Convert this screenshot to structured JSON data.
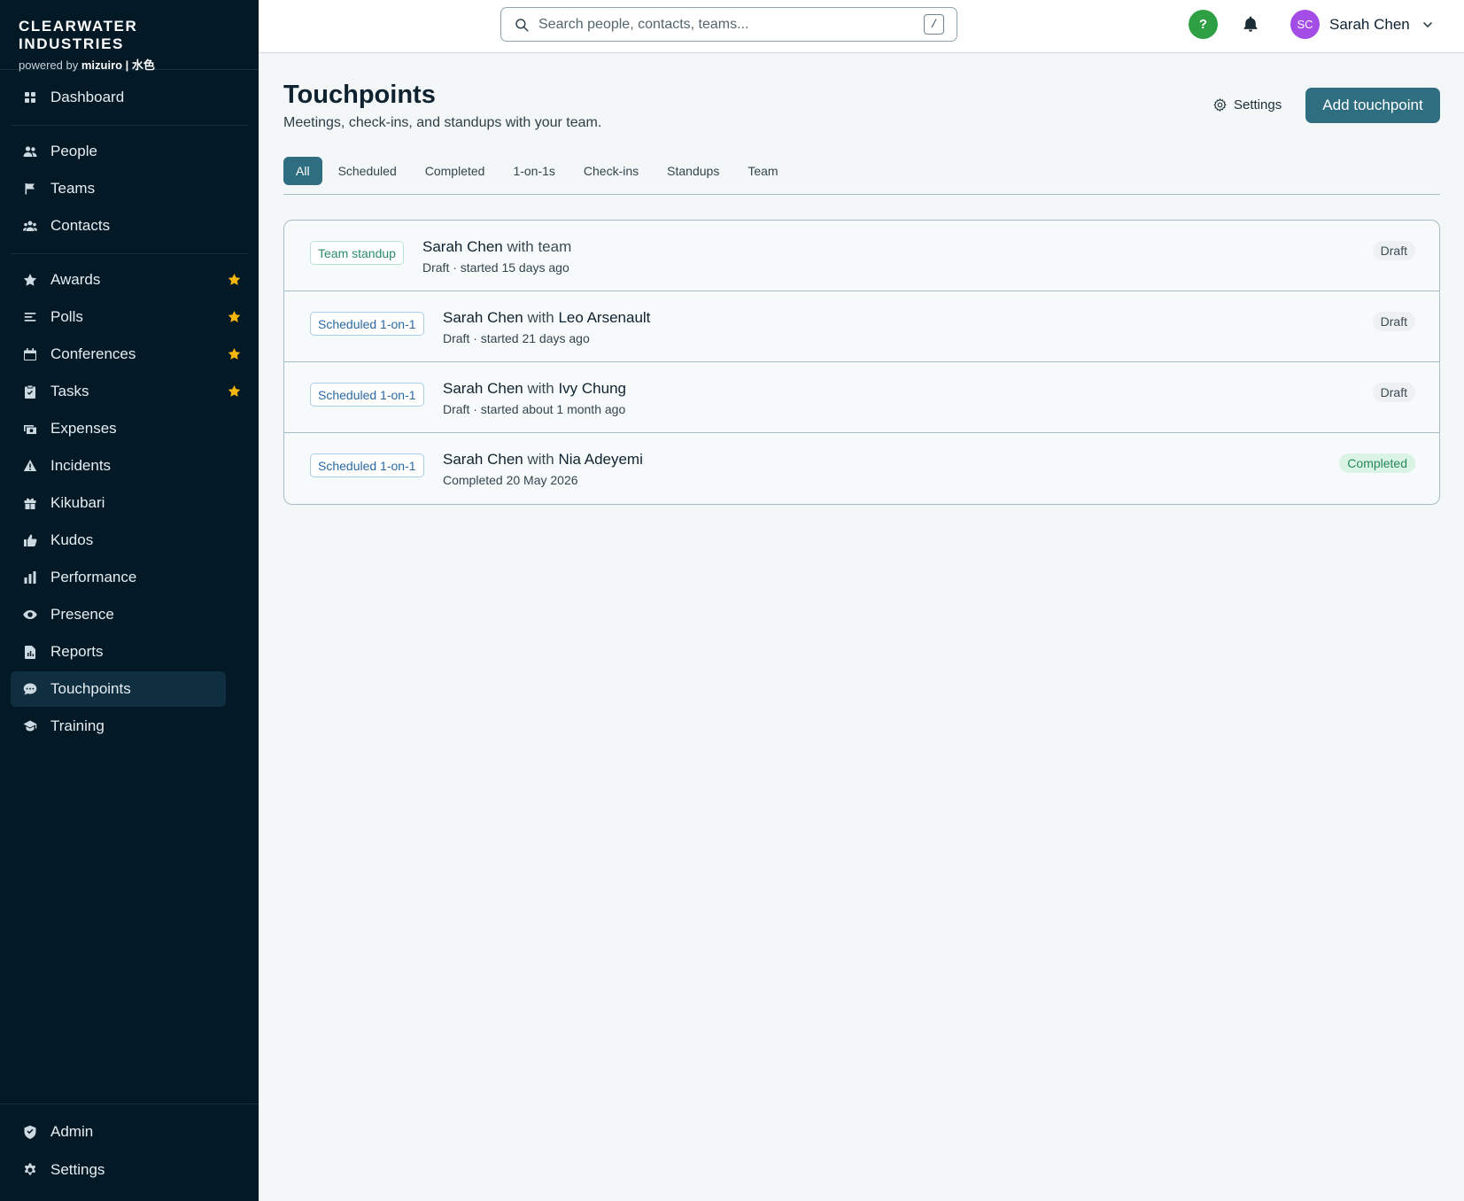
{
  "brand": {
    "name": "CLEARWATER INDUSTRIES",
    "powered_prefix": "powered by",
    "powered_name": "mizuiro | 水色"
  },
  "sidebar": {
    "items": [
      {
        "label": "Dashboard",
        "icon": "dashboard-icon",
        "starred": false,
        "active": false
      },
      {
        "label": "People",
        "icon": "people-icon",
        "starred": false,
        "active": false
      },
      {
        "label": "Teams",
        "icon": "flag-icon",
        "starred": false,
        "active": false
      },
      {
        "label": "Contacts",
        "icon": "contacts-icon",
        "starred": false,
        "active": false
      },
      {
        "label": "Awards",
        "icon": "star-icon",
        "starred": true,
        "active": false
      },
      {
        "label": "Polls",
        "icon": "polls-icon",
        "starred": true,
        "active": false
      },
      {
        "label": "Conferences",
        "icon": "calendar-icon",
        "starred": true,
        "active": false
      },
      {
        "label": "Tasks",
        "icon": "clipboard-check-icon",
        "starred": true,
        "active": false
      },
      {
        "label": "Expenses",
        "icon": "money-icon",
        "starred": false,
        "active": false
      },
      {
        "label": "Incidents",
        "icon": "warning-icon",
        "starred": false,
        "active": false
      },
      {
        "label": "Kikubari",
        "icon": "gift-icon",
        "starred": false,
        "active": false
      },
      {
        "label": "Kudos",
        "icon": "thumbs-up-icon",
        "starred": false,
        "active": false
      },
      {
        "label": "Performance",
        "icon": "bar-chart-icon",
        "starred": false,
        "active": false
      },
      {
        "label": "Presence",
        "icon": "eye-icon",
        "starred": false,
        "active": false
      },
      {
        "label": "Reports",
        "icon": "report-icon",
        "starred": false,
        "active": false
      },
      {
        "label": "Touchpoints",
        "icon": "chat-icon",
        "starred": false,
        "active": true
      },
      {
        "label": "Training",
        "icon": "graduation-cap-icon",
        "starred": false,
        "active": false
      }
    ],
    "bottom": [
      {
        "label": "Admin",
        "icon": "shield-icon"
      },
      {
        "label": "Settings",
        "icon": "gear-icon"
      }
    ]
  },
  "topbar": {
    "search_placeholder": "Search people, contacts, teams...",
    "search_shortcut": "/",
    "help_label": "?",
    "user_initials": "SC",
    "user_name": "Sarah Chen"
  },
  "page": {
    "title": "Touchpoints",
    "subtitle": "Meetings, check-ins, and standups with your team.",
    "settings_label": "Settings",
    "add_label": "Add touchpoint"
  },
  "tabs": [
    {
      "label": "All",
      "active": true
    },
    {
      "label": "Scheduled",
      "active": false
    },
    {
      "label": "Completed",
      "active": false
    },
    {
      "label": "1-on-1s",
      "active": false
    },
    {
      "label": "Check-ins",
      "active": false
    },
    {
      "label": "Standups",
      "active": false
    },
    {
      "label": "Team",
      "active": false
    }
  ],
  "touchpoints": [
    {
      "type": "Team standup",
      "kind": "standup",
      "owner": "Sarah Chen",
      "with_word": "with",
      "with": "team",
      "with_strong": false,
      "meta": "Draft · started 15 days ago",
      "status": "Draft",
      "status_kind": "draft"
    },
    {
      "type": "Scheduled 1-on-1",
      "kind": "oneonone",
      "owner": "Sarah Chen",
      "with_word": "with",
      "with": "Leo Arsenault",
      "with_strong": true,
      "meta": "Draft · started 21 days ago",
      "status": "Draft",
      "status_kind": "draft"
    },
    {
      "type": "Scheduled 1-on-1",
      "kind": "oneonone",
      "owner": "Sarah Chen",
      "with_word": "with",
      "with": "Ivy Chung",
      "with_strong": true,
      "meta": "Draft · started about 1 month ago",
      "status": "Draft",
      "status_kind": "draft"
    },
    {
      "type": "Scheduled 1-on-1",
      "kind": "oneonone",
      "owner": "Sarah Chen",
      "with_word": "with",
      "with": "Nia Adeyemi",
      "with_strong": true,
      "meta": "Completed 20 May 2026",
      "status": "Completed",
      "status_kind": "completed"
    }
  ],
  "colors": {
    "sidebar_bg": "#031926",
    "accent": "#2f6e80",
    "star": "#f5b50a",
    "help": "#2ea043",
    "avatar": "#a44ce6"
  }
}
